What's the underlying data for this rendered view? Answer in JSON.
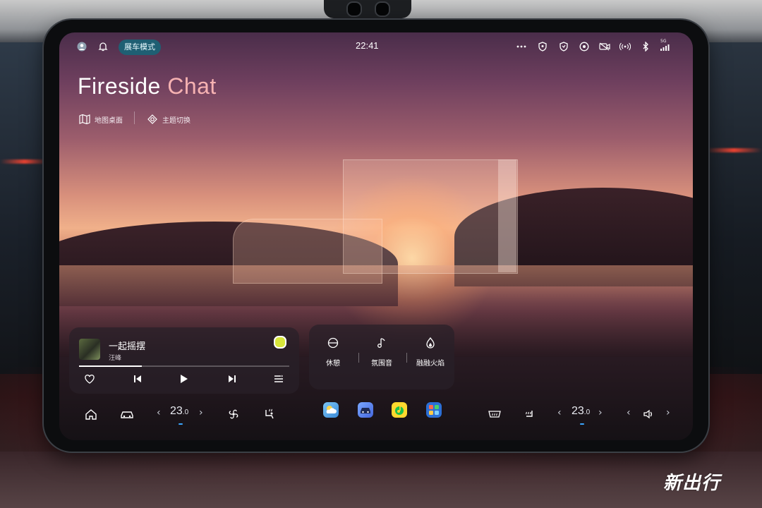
{
  "status_bar": {
    "mode_pill": "展车模式",
    "clock": "22:41",
    "icons_left": [
      "avatar-icon",
      "bell-icon"
    ],
    "icons_right": [
      "more-icon",
      "shield-icon",
      "sentry-icon",
      "navigation-icon",
      "camera-off-icon",
      "wifi-hotspot-icon",
      "bluetooth-icon",
      "signal-5g-icon"
    ],
    "signal_label": "5G"
  },
  "theme": {
    "title_part1": "Fireside",
    "title_part2": "Chat",
    "quick_actions": [
      {
        "label": "地图桌面",
        "icon": "map-icon"
      },
      {
        "label": "主题切换",
        "icon": "theme-switch-icon"
      }
    ]
  },
  "music_card": {
    "song": "一起摇摆",
    "artist": "汪峰",
    "progress": 0.3,
    "controls": [
      "heart-icon",
      "previous-icon",
      "play-icon",
      "next-icon",
      "playlist-icon"
    ]
  },
  "scene_card": {
    "items": [
      {
        "label": "休憩",
        "icon": "rest-icon"
      },
      {
        "label": "氛围音",
        "icon": "music-note-icon"
      },
      {
        "label": "融融火焰",
        "icon": "flame-icon"
      }
    ]
  },
  "dock": {
    "left_temp": "23",
    "left_temp_decimal": ".0",
    "right_temp": "23",
    "right_temp_decimal": ".0",
    "left_icons": [
      "home-icon",
      "car-icon",
      "fan-icon",
      "seat-heat-icon"
    ],
    "apps": [
      "weather-app",
      "car-app",
      "qq-music-app",
      "app-grid-app"
    ],
    "right_icons": [
      "rear-defrost-icon",
      "seat-heat-icon",
      "volume-icon"
    ]
  },
  "watermark": "新出行",
  "colors": {
    "pill_bg": "#1f5f73",
    "title_accent": "#f6b2b2",
    "temp_indicator": "#3ba6ff"
  }
}
